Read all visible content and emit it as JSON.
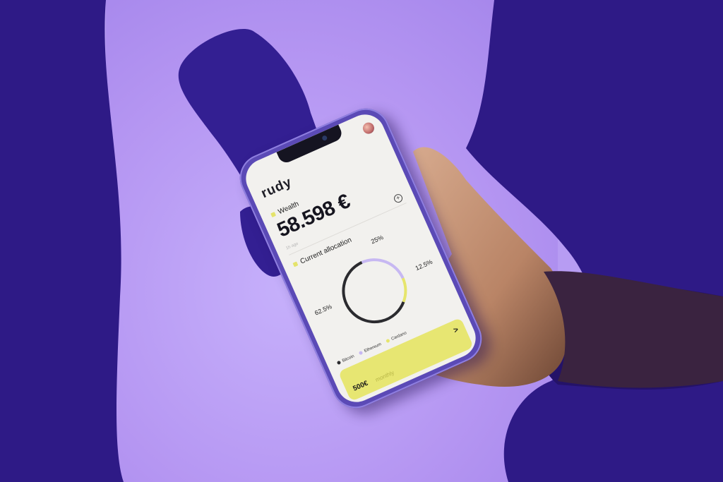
{
  "app": {
    "logo": "rudy",
    "wealth_label": "Wealth",
    "wealth_amount": "58.598 €",
    "wealth_sub": "1h ago",
    "allocation_label": "Current allocation",
    "allocation": [
      {
        "name": "Bitcoin",
        "percent_label": "62.5%",
        "value": 62.5,
        "color": "#2b2b2f"
      },
      {
        "name": "Ethereum",
        "percent_label": "25%",
        "value": 25,
        "color": "#c7b8f2"
      },
      {
        "name": "Cardano",
        "percent_label": "12.5%",
        "value": 12.5,
        "color": "#e6e56c"
      }
    ],
    "cta_amount": "500€",
    "cta_sub": "monthly",
    "cta_arrow": ">"
  },
  "icons": {
    "plus": "plus-icon",
    "arrow": "chevron-right-icon",
    "avatar": "avatar"
  },
  "colors": {
    "background": "#b79cf3",
    "shadow": "#2e1a86",
    "accent_yellow": "#e7e672",
    "phone_frame": "#5b4ab6"
  }
}
